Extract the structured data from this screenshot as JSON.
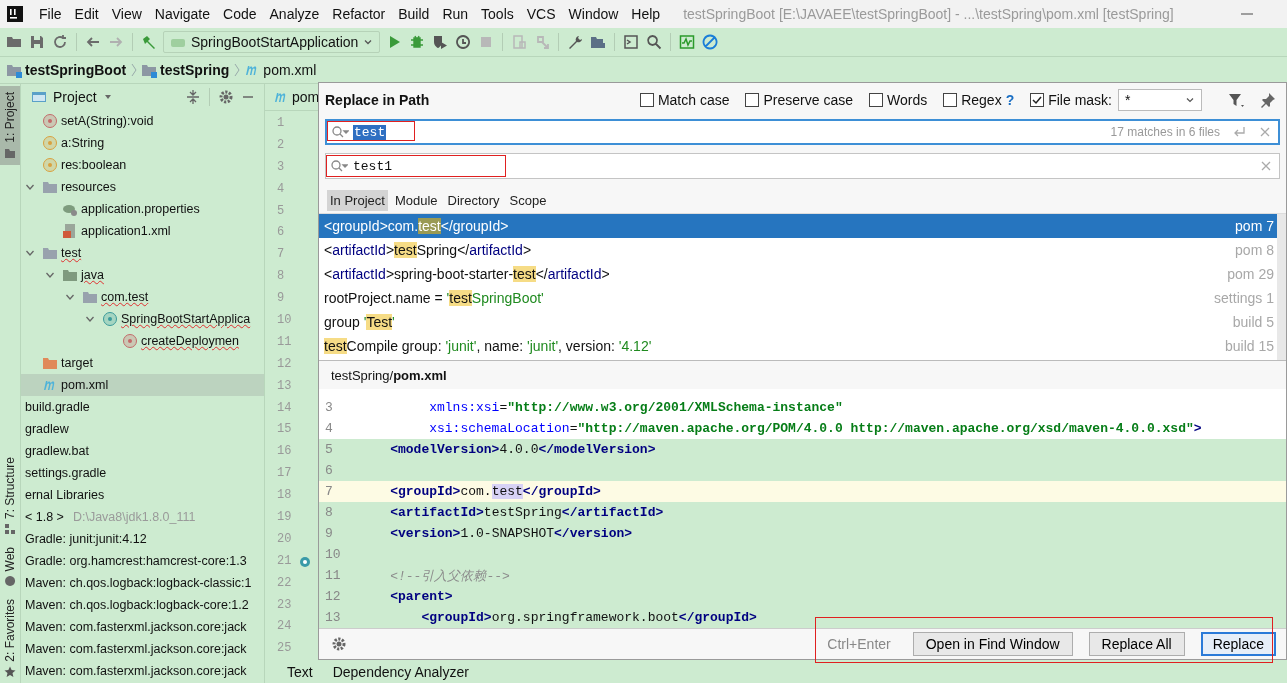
{
  "window": {
    "title": "testSpringBoot [E:\\JAVAEE\\testSpringBoot] - ...\\testSpring\\pom.xml [testSpring]"
  },
  "menu": [
    "File",
    "Edit",
    "View",
    "Navigate",
    "Code",
    "Analyze",
    "Refactor",
    "Build",
    "Run",
    "Tools",
    "VCS",
    "Window",
    "Help"
  ],
  "toolbar": {
    "run_configuration": "SpringBootStartApplication"
  },
  "breadcrumb": [
    {
      "label": "testSpringBoot",
      "kind": "folder"
    },
    {
      "label": "testSpring",
      "kind": "folder"
    },
    {
      "label": "pom.xml",
      "kind": "maven"
    }
  ],
  "side_tabs": [
    {
      "label": "1: Project",
      "kind": "folder",
      "selected": true
    },
    {
      "label": "7: Structure",
      "kind": "structure",
      "selected": false
    },
    {
      "label": "Web",
      "kind": "globe",
      "selected": false
    },
    {
      "label": "2: Favorites",
      "kind": "star",
      "selected": false
    }
  ],
  "project": {
    "title": "Project",
    "tree": [
      {
        "label": "setA(String):void",
        "kind": "method",
        "selected": false,
        "error": false
      },
      {
        "label": "a:String",
        "kind": "field",
        "selected": false,
        "error": false
      },
      {
        "label": "res:boolean",
        "kind": "field",
        "selected": false,
        "error": false
      },
      {
        "label": "resources",
        "kind": "resources",
        "expanded": true,
        "selected": false,
        "error": false,
        "children": [
          {
            "label": "application.properties",
            "kind": "properties",
            "selected": false,
            "error": false
          },
          {
            "label": "application1.xml",
            "kind": "xml",
            "selected": false,
            "error": false
          }
        ]
      },
      {
        "label": "test",
        "kind": "folder",
        "expanded": true,
        "selected": false,
        "error": true,
        "children": [
          {
            "label": "java",
            "kind": "source",
            "expanded": true,
            "selected": false,
            "error": true,
            "children": [
              {
                "label": "com.test",
                "kind": "package",
                "expanded": true,
                "selected": false,
                "error": true,
                "children": [
                  {
                    "label": "SpringBootStartApplica",
                    "kind": "class",
                    "expanded": true,
                    "selected": false,
                    "error": true,
                    "children": [
                      {
                        "label": "createDeploymen",
                        "kind": "method",
                        "selected": false,
                        "error": true
                      }
                    ]
                  }
                ]
              }
            ]
          }
        ]
      },
      {
        "label": "target",
        "kind": "target",
        "selected": false,
        "error": false
      },
      {
        "label": "pom.xml",
        "kind": "maven",
        "selected": true,
        "error": false
      },
      {
        "label": "build.gradle",
        "kind": "library",
        "selected": false,
        "error": false
      },
      {
        "label": "gradlew",
        "kind": "library",
        "selected": false,
        "error": false
      },
      {
        "label": "gradlew.bat",
        "kind": "library",
        "selected": false,
        "error": false
      },
      {
        "label": "settings.gradle",
        "kind": "library",
        "selected": false,
        "error": false
      },
      {
        "label": "ernal Libraries",
        "kind": "library",
        "selected": false,
        "error": false
      },
      {
        "label": "< 1.8 >",
        "hint": "D:\\Java8\\jdk1.8.0_111",
        "kind": "library",
        "selected": false,
        "error": false
      },
      {
        "label": "Gradle: junit:junit:4.12",
        "kind": "library",
        "selected": false,
        "error": false
      },
      {
        "label": "Gradle: org.hamcrest:hamcrest-core:1.3",
        "kind": "library",
        "selected": false,
        "error": false
      },
      {
        "label": "Maven: ch.qos.logback:logback-classic:1",
        "kind": "library",
        "selected": false,
        "error": false
      },
      {
        "label": "Maven: ch.qos.logback:logback-core:1.2",
        "kind": "library",
        "selected": false,
        "error": false
      },
      {
        "label": "Maven: com.fasterxml.jackson.core:jack",
        "kind": "library",
        "selected": false,
        "error": false
      },
      {
        "label": "Maven: com.fasterxml.jackson.core:jack",
        "kind": "library",
        "selected": false,
        "error": false
      },
      {
        "label": "Maven: com.fasterxml.jackson.core:jack",
        "kind": "library",
        "selected": false,
        "error": false
      }
    ]
  },
  "editor": {
    "tab": "pom",
    "line_numbers": [
      "1",
      "2",
      "3",
      "4",
      "5",
      "6",
      "7",
      "8",
      "9",
      "10",
      "11",
      "12",
      "13",
      "14",
      "15",
      "16",
      "17",
      "18",
      "19",
      "20",
      "21",
      "22",
      "23",
      "24",
      "25"
    ]
  },
  "bottom_tabs": [
    "Text",
    "Dependency Analyzer"
  ],
  "replace_dialog": {
    "title": "Replace in Path",
    "options": [
      {
        "label": "Match case",
        "checked": false
      },
      {
        "label": "Preserve case",
        "checked": false
      },
      {
        "label": "Words",
        "checked": false
      },
      {
        "label": "Regex",
        "help": "?",
        "checked": false
      },
      {
        "label": "File mask:",
        "checked": true
      }
    ],
    "file_mask": "*",
    "search": {
      "value": "test",
      "status": "17 matches in 6 files"
    },
    "replace": {
      "value": "test1"
    },
    "scopes": [
      {
        "label": "In Project",
        "selected": true
      },
      {
        "label": "Module",
        "selected": false
      },
      {
        "label": "Directory",
        "selected": false
      },
      {
        "label": "Scope",
        "selected": false
      }
    ],
    "results": [
      {
        "selected": true,
        "location": "pom 7",
        "parts": [
          {
            "kind": "plain",
            "text": "<groupId>com."
          },
          {
            "kind": "match",
            "text": "test"
          },
          {
            "kind": "plain",
            "text": "</groupId>"
          }
        ]
      },
      {
        "selected": false,
        "location": "pom 8",
        "parts": [
          {
            "kind": "plain",
            "text": "<"
          },
          {
            "kind": "name",
            "text": "artifactId"
          },
          {
            "kind": "plain",
            "text": ">"
          },
          {
            "kind": "match",
            "text": "test"
          },
          {
            "kind": "plain",
            "text": "Spring</"
          },
          {
            "kind": "name",
            "text": "artifactId"
          },
          {
            "kind": "plain",
            "text": ">"
          }
        ]
      },
      {
        "selected": false,
        "location": "pom 29",
        "parts": [
          {
            "kind": "plain",
            "text": "<"
          },
          {
            "kind": "name",
            "text": "artifactId"
          },
          {
            "kind": "plain",
            "text": ">spring-boot-starter-"
          },
          {
            "kind": "match",
            "text": "test"
          },
          {
            "kind": "plain",
            "text": "</"
          },
          {
            "kind": "name",
            "text": "artifactId"
          },
          {
            "kind": "plain",
            "text": ">"
          }
        ]
      },
      {
        "selected": false,
        "location": "settings 1",
        "parts": [
          {
            "kind": "plain",
            "text": "rootProject.name = "
          },
          {
            "kind": "string",
            "text": "'"
          },
          {
            "kind": "match",
            "text": "test"
          },
          {
            "kind": "string",
            "text": "SpringBoot'"
          }
        ]
      },
      {
        "selected": false,
        "location": "build 5",
        "parts": [
          {
            "kind": "plain",
            "text": "group "
          },
          {
            "kind": "string",
            "text": "'"
          },
          {
            "kind": "match",
            "text": "Test"
          },
          {
            "kind": "string",
            "text": "'"
          }
        ]
      },
      {
        "selected": false,
        "location": "build 15",
        "parts": [
          {
            "kind": "match",
            "text": "test"
          },
          {
            "kind": "plain",
            "text": "Compile group: "
          },
          {
            "kind": "string",
            "text": "'junit'"
          },
          {
            "kind": "plain",
            "text": ", name: "
          },
          {
            "kind": "string",
            "text": "'junit'"
          },
          {
            "kind": "plain",
            "text": ", version: "
          },
          {
            "kind": "string",
            "text": "'4.12'"
          }
        ]
      }
    ],
    "preview": {
      "path": "testSpring/**pom.xml**",
      "lines": [
        {
          "number": "3",
          "highlighted": false,
          "current": false,
          "parts": [
            {
              "kind": "attr",
              "text": "         xmlns:xsi"
            },
            {
              "kind": "plain",
              "text": "="
            },
            {
              "kind": "string",
              "text": "\"http://www.w3.org/2001/XMLSchema-instance\""
            }
          ]
        },
        {
          "number": "4",
          "highlighted": false,
          "current": false,
          "parts": [
            {
              "kind": "attr",
              "text": "         xsi:schemaLocation"
            },
            {
              "kind": "plain",
              "text": "="
            },
            {
              "kind": "string",
              "text": "\"http://maven.apache.org/POM/4.0.0 http://maven.apache.org/xsd/maven-4.0.0.xsd\""
            },
            {
              "kind": "tag",
              "text": ">"
            }
          ]
        },
        {
          "number": "5",
          "highlighted": true,
          "current": false,
          "parts": [
            {
              "kind": "tag",
              "text": "    <modelVersion>"
            },
            {
              "kind": "plain",
              "text": "4.0.0"
            },
            {
              "kind": "tag",
              "text": "</modelVersion>"
            }
          ]
        },
        {
          "number": "6",
          "highlighted": true,
          "current": false
        },
        {
          "number": "7",
          "current": true,
          "parts": [
            {
              "kind": "tag",
              "text": "    <groupId>"
            },
            {
              "kind": "plain",
              "text": "com."
            },
            {
              "kind": "match",
              "text": "test"
            },
            {
              "kind": "tag",
              "text": "</groupId>"
            }
          ]
        },
        {
          "number": "8",
          "highlighted": true,
          "current": false,
          "parts": [
            {
              "kind": "tag",
              "text": "    <artifactId>"
            },
            {
              "kind": "plain",
              "text": "testSpring"
            },
            {
              "kind": "tag",
              "text": "</artifactId>"
            }
          ]
        },
        {
          "number": "9",
          "highlighted": true,
          "current": false,
          "parts": [
            {
              "kind": "tag",
              "text": "    <version>"
            },
            {
              "kind": "plain",
              "text": "1.0-SNAPSHOT"
            },
            {
              "kind": "tag",
              "text": "</version>"
            }
          ]
        },
        {
          "number": "10",
          "highlighted": true,
          "current": false
        },
        {
          "number": "11",
          "highlighted": true,
          "current": false,
          "parts": [
            {
              "kind": "comment",
              "text": "    <!--引入父依赖-->"
            }
          ]
        },
        {
          "number": "12",
          "highlighted": true,
          "current": false,
          "parts": [
            {
              "kind": "tag",
              "text": "    <parent>"
            }
          ]
        },
        {
          "number": "13",
          "highlighted": true,
          "current": false,
          "parts": [
            {
              "kind": "tag",
              "text": "        <groupId>"
            },
            {
              "kind": "plain",
              "text": "org.springframework.boot"
            },
            {
              "kind": "tag",
              "text": "</groupId>"
            }
          ]
        }
      ]
    },
    "shortcut": "Ctrl+Enter",
    "buttons": [
      {
        "label": "Open in Find Window",
        "default": false
      },
      {
        "label": "Replace All",
        "default": false
      },
      {
        "label": "Replace",
        "default": true
      }
    ]
  }
}
